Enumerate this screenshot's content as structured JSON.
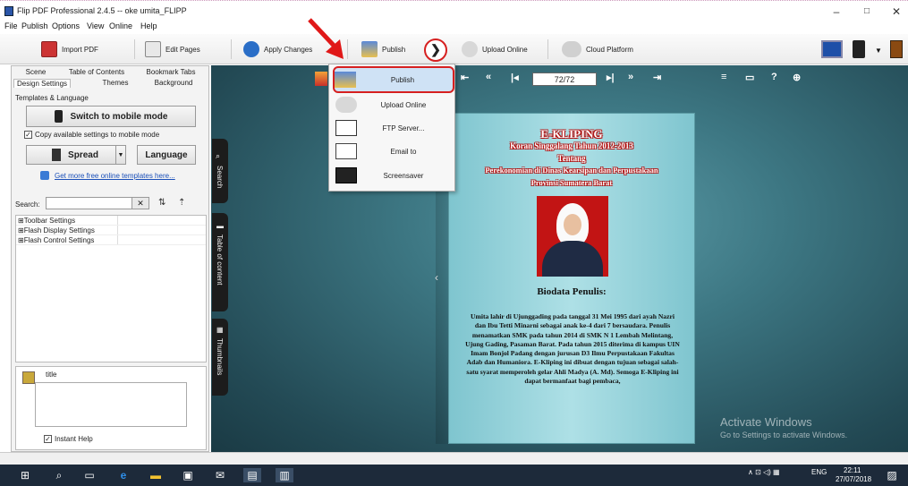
{
  "window": {
    "title": "Flip PDF Professional 2.4.5  -- oke umita_FLIPP",
    "min": "–",
    "max": "□",
    "close": "✕"
  },
  "menu": [
    "File",
    "Publish",
    "Options",
    "View",
    "Online",
    "Help"
  ],
  "toolbar": {
    "import_pdf": "Import PDF",
    "edit_pages": "Edit Pages",
    "apply_changes": "Apply Changes",
    "publish": "Publish",
    "arrow": "❯",
    "upload_online": "Upload Online",
    "cloud_platform": "Cloud Platform"
  },
  "left_panel": {
    "tabs_row1": [
      "Scene",
      "Table of Contents",
      "Bookmark Tabs"
    ],
    "tabs_row2": [
      "Design Settings",
      "Themes",
      "Background"
    ],
    "section": "Templates & Language",
    "switch_mobile": "Switch to mobile mode",
    "copy_settings": "Copy available settings to mobile mode",
    "spread": "Spread",
    "language": "Language",
    "more_templates": "Get more free online templates here...",
    "search_label": "Search:",
    "tree": [
      "⊞Toolbar Settings",
      "⊞Flash Display Settings",
      "⊞Flash Control Settings"
    ],
    "help_title": "title",
    "instant_help": "Instant Help"
  },
  "dropdown": {
    "items": [
      "Publish",
      "Upload Online",
      "FTP Server...",
      "Email to",
      "Screensaver"
    ]
  },
  "viewer": {
    "page": "72/72",
    "side_tabs": [
      "Search",
      "Table of content",
      "Thumbnails"
    ]
  },
  "book": {
    "title": "E-KLIPING",
    "subtitle": "Koran Singgalang Tahun 2012-2013",
    "tentang": "Tentang",
    "line3": "Perekonomian di Dinas Kearsipan dan Perpustakaan",
    "line4": "Provinsi Sumatera Barat",
    "biodata": "Biodata Penulis:",
    "bio": "Umita lahir di Ujunggading pada tanggal 31 Mei 1995 dari ayah Nazri dan Ibu Tetti Minarni sebagai anak ke-4 dari 7 bersaudara. Penulis menamatkan SMK pada tahun 2014 di SMK N 1 Lembah Melintang, Ujung Gading, Pasaman Barat. Pada tahun 2015 diterima di kampus UIN Imam Bonjol Padang dengan jurusan D3 Ilmu Perpustakaan Fakultas Adab dan Humaniora. E-Kliping ini dibuat dengan tujuan sebagai salah-satu syarat memperoleh gelar Ahli Madya (A. Md). Semoga E-Kliping ini dapat bermanfaat bagi pembaca,"
  },
  "watermark": {
    "line1": "Activate Windows",
    "line2": "Go to Settings to activate Windows."
  },
  "tray": {
    "lang": "ENG",
    "time": "22:11",
    "date": "27/07/2018"
  }
}
